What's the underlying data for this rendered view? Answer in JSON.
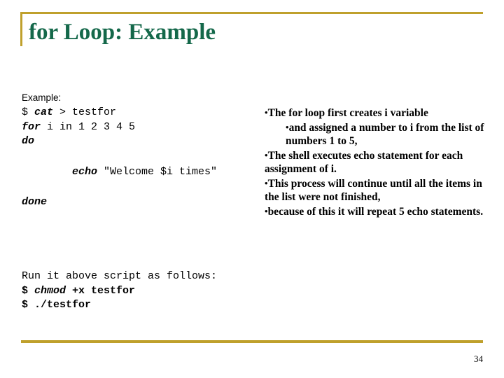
{
  "slide": {
    "title": "for Loop: Example",
    "title_color": "#14684A",
    "accent_color": "#BFA02C",
    "background_color": "#FFFFFF",
    "page_number": "34"
  },
  "code": {
    "intro_label": "Example:",
    "lines": [
      {
        "prompt": "$ ",
        "keyword": "cat",
        "rest": " > testfor"
      },
      {
        "prompt": "",
        "keyword": "for",
        "rest": " i in 1 2 3 4 5"
      },
      {
        "prompt": "",
        "keyword": "do",
        "rest": ""
      },
      {
        "prompt": "        ",
        "keyword": "echo",
        "rest": " \"Welcome $i times\""
      },
      {
        "prompt": "",
        "keyword": "done",
        "rest": ""
      }
    ],
    "line_1_full": "$ cat > testfor",
    "line_2_full": "for i in 1 2 3 4 5",
    "line_3_full": "do",
    "line_4_full": "        echo \"Welcome $i times\"",
    "line_5_full": "done"
  },
  "run": {
    "instruction": "Run it above script as follows:",
    "line_1_prompt": "$ ",
    "line_1_keyword": "chmod",
    "line_1_rest": " +x testfor",
    "line_2": "$ ./testfor"
  },
  "notes": {
    "bullet_char": "•",
    "items": [
      {
        "level": 0,
        "text": "The for loop first creates i variable"
      },
      {
        "level": 1,
        "text": "and assigned a number to i from the list of numbers 1 to 5,"
      },
      {
        "level": 0,
        "text": "The shell executes echo statement for each assignment of i."
      },
      {
        "level": 0,
        "text": "This process will continue until all the items in the list were not finished,"
      },
      {
        "level": 0,
        "text": "because of this it will repeat 5 echo statements."
      }
    ]
  }
}
